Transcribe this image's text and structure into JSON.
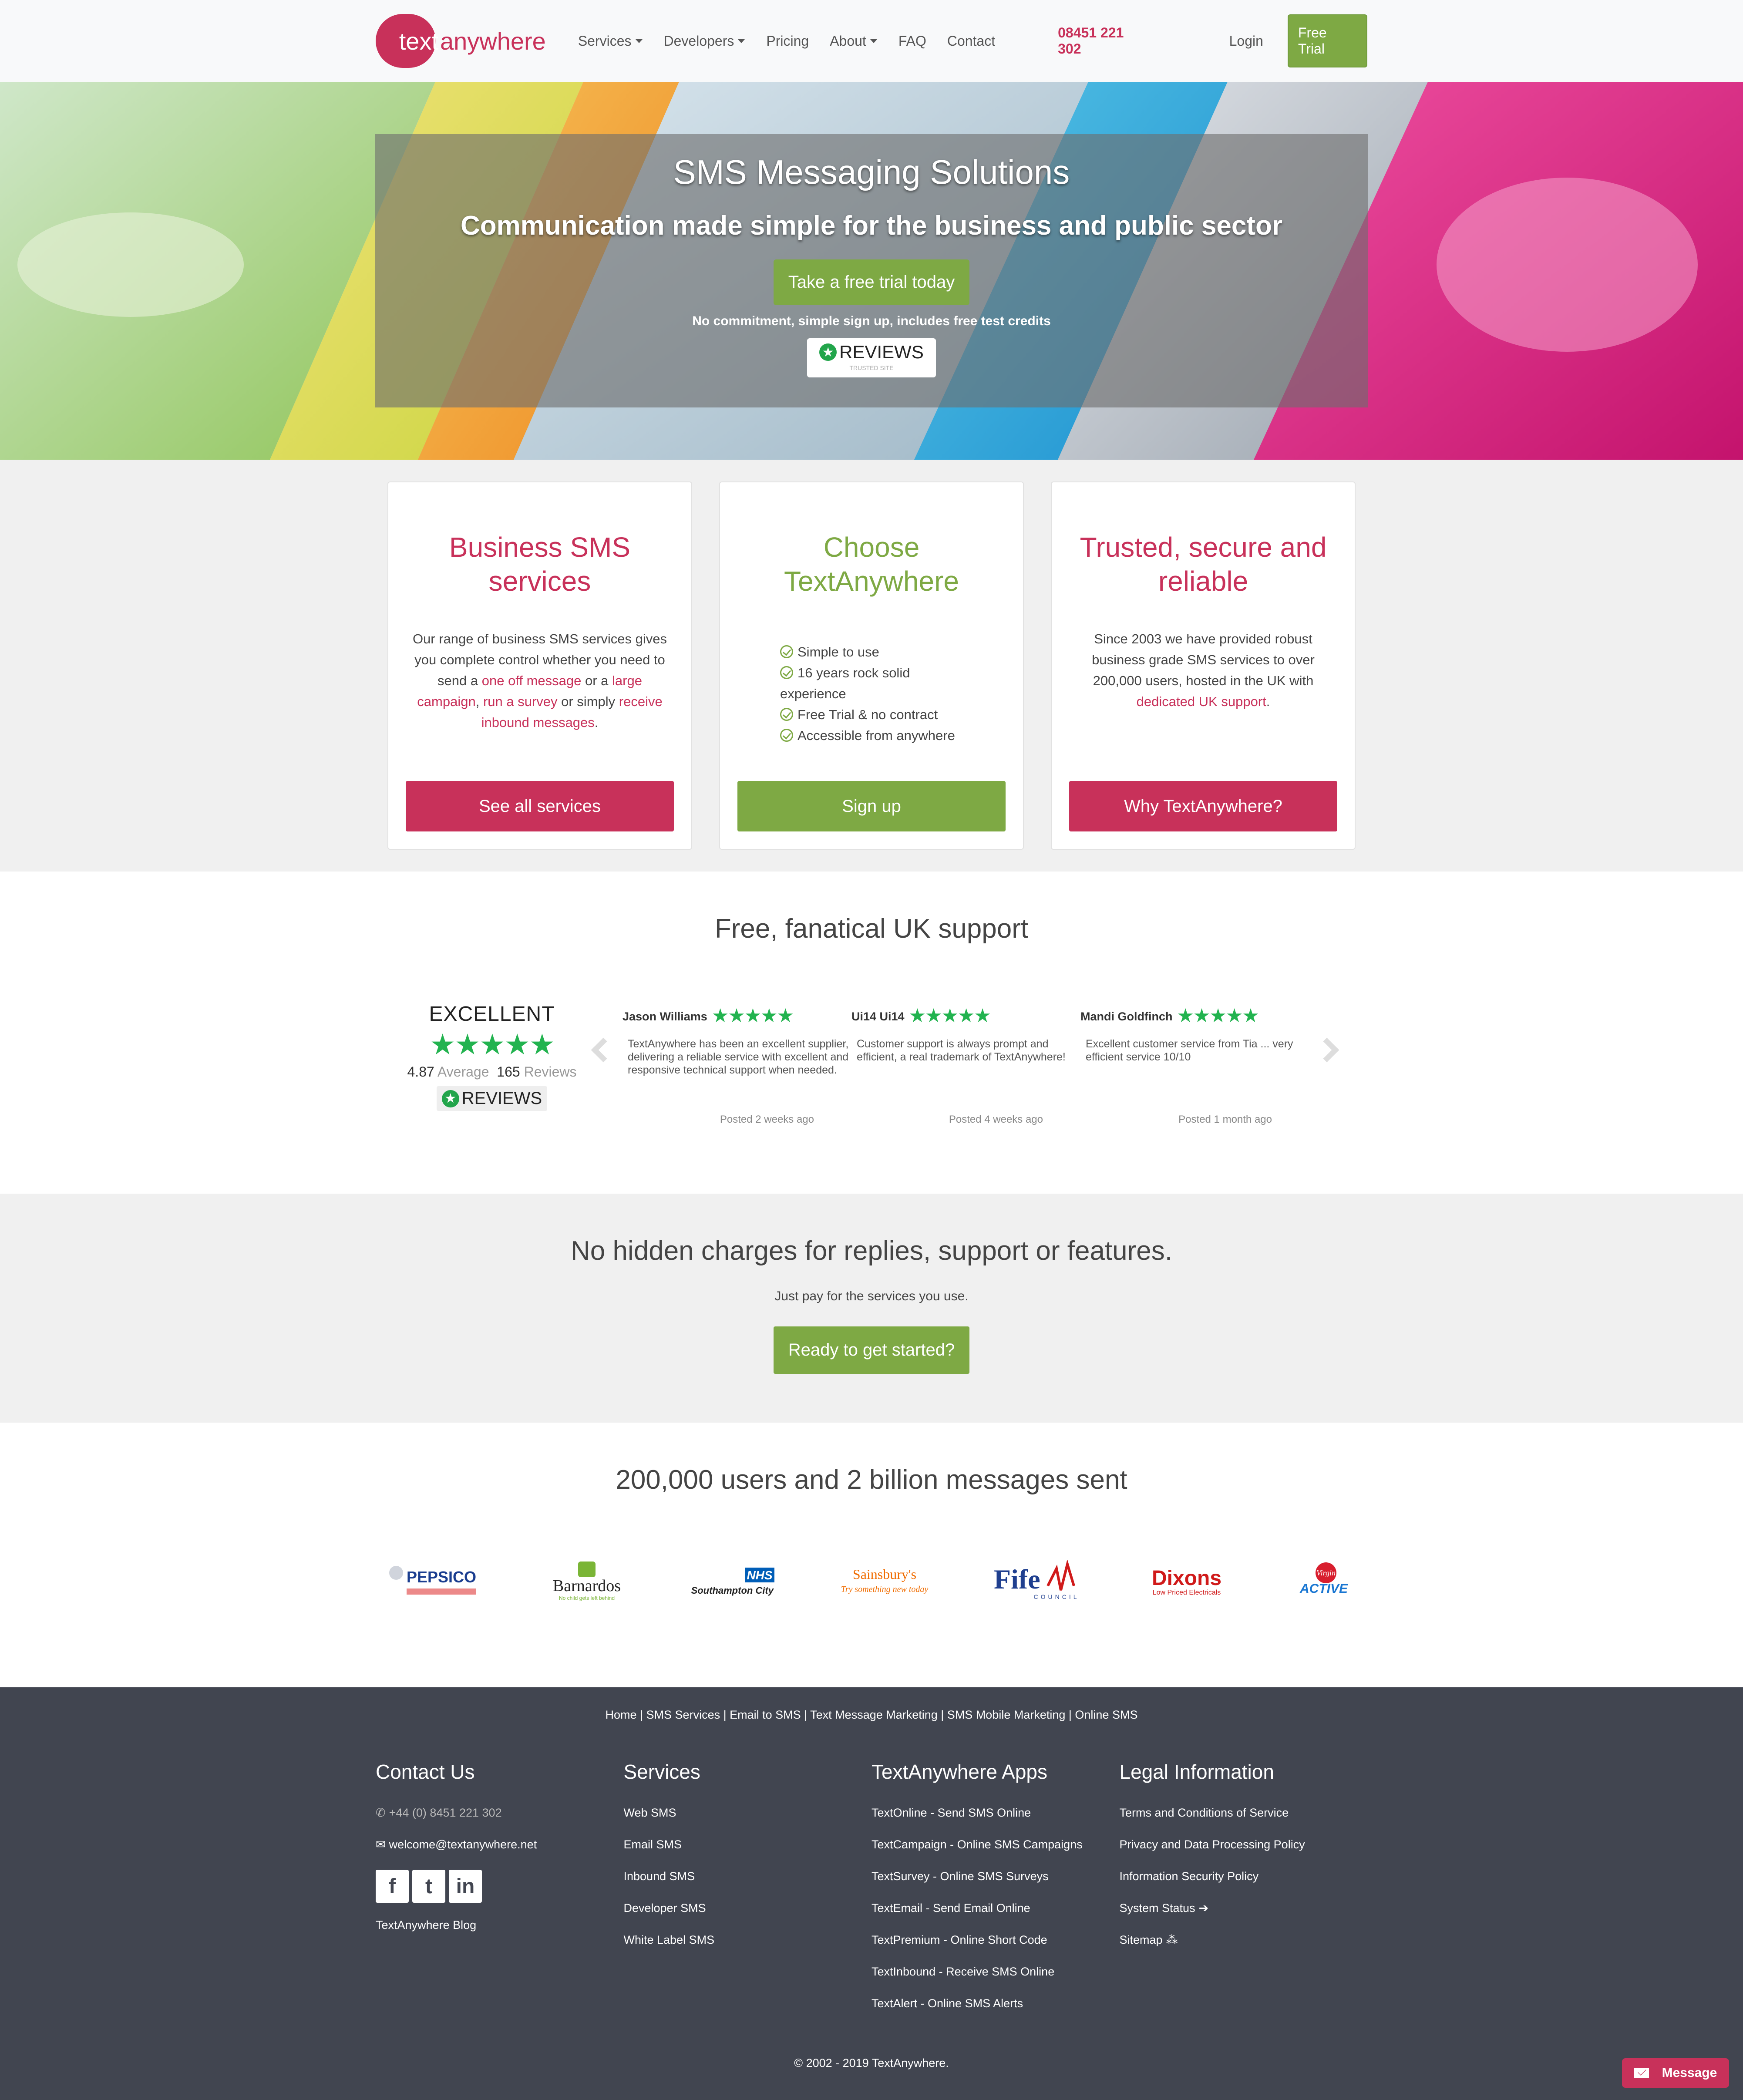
{
  "nav": {
    "logo_text": "text",
    "logo_text2": "anywhere",
    "links": [
      "Services",
      "Developers",
      "Pricing",
      "About",
      "FAQ",
      "Contact"
    ],
    "phone": "08451 221 302",
    "login": "Login",
    "free_trial": "Free Trial"
  },
  "hero": {
    "title": "SMS Messaging Solutions",
    "subtitle": "Communication made simple for the business and public sector",
    "cta": "Take a free trial today",
    "note": "No commitment, simple sign up, includes free test credits",
    "badge": "REVIEWS",
    "badge_sub": "TRUSTED SITE"
  },
  "cards": [
    {
      "title": "Business SMS services",
      "text_parts": [
        "Our range of business SMS services gives you complete control whether you need to send a ",
        "one off message",
        " or a ",
        "large campaign",
        ", ",
        "run a survey",
        " or simply ",
        "receive inbound messages",
        "."
      ],
      "button": "See all services"
    },
    {
      "title": "Choose TextAnywhere",
      "checklist": [
        "Simple to use",
        "16 years rock solid experience",
        "Free Trial & no contract",
        "Accessible from anywhere"
      ],
      "button": "Sign up"
    },
    {
      "title": "Trusted, secure and reliable",
      "text_parts": [
        "Since 2003 we have provided robust business grade SMS services to over 200,000 users, hosted in the UK with ",
        "dedicated UK support",
        "."
      ],
      "button": "Why TextAnywhere?"
    }
  ],
  "support": {
    "heading": "Free, fanatical UK support",
    "rating_label": "EXCELLENT",
    "stars": "★★★★★",
    "average_value": "4.87",
    "average_label": "Average",
    "count_value": "165",
    "count_label": "Reviews",
    "badge": "REVIEWS",
    "reviews": [
      {
        "name": "Jason Williams",
        "stars": "★★★★★",
        "text": "TextAnywhere has been an excellent supplier, delivering a reliable service with excellent and responsive technical support when needed.",
        "posted": "Posted 2 weeks ago"
      },
      {
        "name": "Ui14 Ui14",
        "stars": "★★★★★",
        "text": "Customer support is always prompt and efficient, a real trademark of TextAnywhere!",
        "posted": "Posted 4 weeks ago"
      },
      {
        "name": "Mandi Goldfinch",
        "stars": "★★★★★",
        "text": "Excellent customer service from Tia ... very efficient service 10/10",
        "posted": "Posted 1 month ago"
      }
    ]
  },
  "charges": {
    "heading": "No hidden charges for replies, support or features.",
    "sub": "Just pay for the services you use.",
    "cta": "Ready to get started?"
  },
  "users": {
    "heading": "200,000 users and 2 billion messages sent",
    "logos": [
      {
        "name": "PEPSICO",
        "color": "#1a3d8f"
      },
      {
        "name": "Barnardos",
        "color": "#222222",
        "tag": "No child gets left behind"
      },
      {
        "name": "Southampton City",
        "color": "#005eb8",
        "tag": "NHS"
      },
      {
        "name": "Sainsbury's",
        "color": "#f06c00",
        "tag": "Try something new today"
      },
      {
        "name": "Fife",
        "color": "#1f3f8f",
        "tag": "COUNCIL"
      },
      {
        "name": "Dixons",
        "color": "#d01a1a",
        "tag": "Low Priced Electricals"
      },
      {
        "name": "ACTIVE",
        "color": "#1976d2",
        "tag": "Virgin"
      }
    ]
  },
  "footer": {
    "links": "Home | SMS Services | Email to SMS | Text Message Marketing | SMS Mobile Marketing | Online SMS",
    "contact": {
      "heading": "Contact Us",
      "phone": "+44 (0) 8451 221 302",
      "email": "welcome@textanywhere.net",
      "blog": "TextAnywhere Blog"
    },
    "services": {
      "heading": "Services",
      "items": [
        "Web SMS",
        "Email SMS",
        "Inbound SMS",
        "Developer SMS",
        "White Label SMS"
      ]
    },
    "apps": {
      "heading": "TextAnywhere Apps",
      "items": [
        "TextOnline - Send SMS Online",
        "TextCampaign - Online SMS Campaigns",
        "TextSurvey - Online SMS Surveys",
        "TextEmail - Send Email Online",
        "TextPremium - Online Short Code",
        "TextInbound - Receive SMS Online",
        "TextAlert - Online SMS Alerts"
      ]
    },
    "legal": {
      "heading": "Legal Information",
      "items": [
        "Terms and Conditions of Service",
        "Privacy and Data Processing Policy",
        "Information Security Policy",
        "System Status",
        "Sitemap"
      ]
    },
    "copyright": "© 2002 - 2019 TextAnywhere.",
    "message_button": "Message"
  }
}
